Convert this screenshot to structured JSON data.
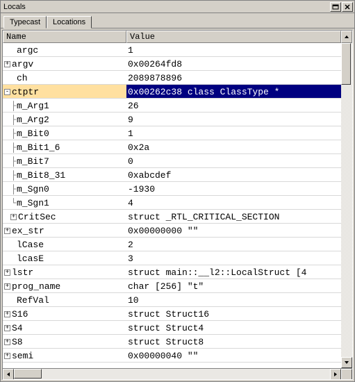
{
  "title": "Locals",
  "tabs": [
    {
      "label": "Typecast",
      "active": true
    },
    {
      "label": "Locations",
      "active": false
    }
  ],
  "columns": {
    "name": "Name",
    "value": "Value"
  },
  "rows": [
    {
      "indent": 1,
      "icon": "",
      "name": "argc",
      "value": "1"
    },
    {
      "indent": 0,
      "icon": "+",
      "name": "argv",
      "value": "0x00264fd8"
    },
    {
      "indent": 1,
      "icon": "",
      "name": "ch",
      "value": "2089878896"
    },
    {
      "indent": 0,
      "icon": "-",
      "name": "ctptr",
      "value": "0x00262c38 class ClassType *",
      "selected": true
    },
    {
      "indent": 1,
      "icon": "|",
      "name": "m_Arg1",
      "value": "26"
    },
    {
      "indent": 1,
      "icon": "|",
      "name": "m_Arg2",
      "value": "9"
    },
    {
      "indent": 1,
      "icon": "|",
      "name": "m_Bit0",
      "value": "1"
    },
    {
      "indent": 1,
      "icon": "|",
      "name": "m_Bit1_6",
      "value": "0x2a"
    },
    {
      "indent": 1,
      "icon": "|",
      "name": "m_Bit7",
      "value": "0"
    },
    {
      "indent": 1,
      "icon": "|",
      "name": "m_Bit8_31",
      "value": "0xabcdef"
    },
    {
      "indent": 1,
      "icon": "|",
      "name": "m_Sgn0",
      "value": "-1930"
    },
    {
      "indent": 1,
      "icon": "L",
      "name": "m_Sgn1",
      "value": "4"
    },
    {
      "indent": 1,
      "icon": "+",
      "name": "CritSec",
      "value": "struct _RTL_CRITICAL_SECTION"
    },
    {
      "indent": 0,
      "icon": "+",
      "name": "ex_str",
      "value": "0x00000000 \"\""
    },
    {
      "indent": 1,
      "icon": "",
      "name": "lCase",
      "value": "2"
    },
    {
      "indent": 1,
      "icon": "",
      "name": "lcasE",
      "value": "3"
    },
    {
      "indent": 0,
      "icon": "+",
      "name": "lstr",
      "value": "struct main::__l2::LocalStruct [4"
    },
    {
      "indent": 0,
      "icon": "+",
      "name": "prog_name",
      "value": "char [256] \"t\""
    },
    {
      "indent": 1,
      "icon": "",
      "name": "RefVal",
      "value": "10"
    },
    {
      "indent": 0,
      "icon": "+",
      "name": "S16",
      "value": "struct Struct16"
    },
    {
      "indent": 0,
      "icon": "+",
      "name": "S4",
      "value": "struct Struct4"
    },
    {
      "indent": 0,
      "icon": "+",
      "name": "S8",
      "value": "struct Struct8"
    },
    {
      "indent": 0,
      "icon": "+",
      "name": "semi",
      "value": "0x00000040 \"\""
    }
  ]
}
